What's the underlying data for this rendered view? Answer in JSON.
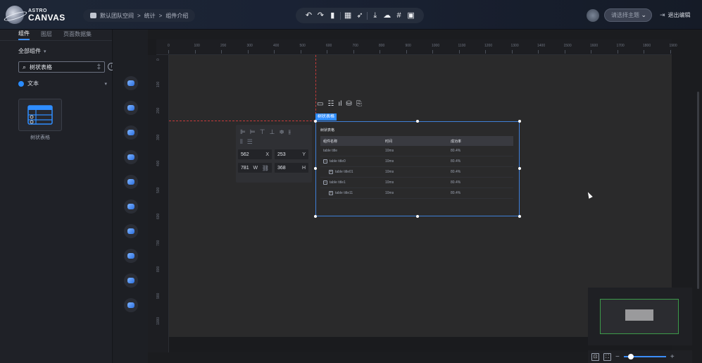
{
  "app": {
    "logo_small": "ASTRO",
    "logo_big": "CANVAS"
  },
  "breadcrumb": {
    "items": [
      "默认团队空间",
      "统计",
      "组件介绍"
    ],
    "separator": ">"
  },
  "header": {
    "theme_placeholder": "请选择主题",
    "exit_label": "退出编辑",
    "toolbar_icons": [
      "undo-icon",
      "redo-icon",
      "save-icon",
      "preview-icon",
      "publish-icon",
      "download-icon",
      "upload-icon",
      "grid-icon",
      "settings-icon"
    ]
  },
  "left_panel": {
    "tabs": [
      "组件",
      "图层",
      "页面数据集"
    ],
    "active_tab": "组件",
    "category": "全部组件",
    "search_value": "树状表格",
    "type_label": "文本",
    "component_label": "树状表格"
  },
  "rulers": {
    "top_ticks": [
      "0",
      "100",
      "200",
      "300",
      "400",
      "500",
      "600",
      "700",
      "800",
      "900",
      "1000",
      "1100",
      "1200",
      "1300",
      "1400",
      "1500",
      "1600",
      "1700",
      "1800",
      "1900"
    ],
    "left_ticks": [
      "0",
      "100",
      "200",
      "300",
      "400",
      "500",
      "600",
      "700",
      "800",
      "900",
      "1000"
    ]
  },
  "properties": {
    "x_value": "562",
    "x_label": "X",
    "y_value": "253",
    "y_label": "Y",
    "w_value": "781",
    "w_label": "W",
    "h_value": "368",
    "h_label": "H"
  },
  "widget": {
    "tag": "树状表格",
    "title": "树状表格",
    "columns": [
      "组件名称",
      "时间",
      "成功率"
    ],
    "rows": [
      {
        "name": "table title",
        "time": "10ms",
        "rate": "80.4%",
        "level": 0,
        "expander": ""
      },
      {
        "name": "table title0",
        "time": "10ms",
        "rate": "80.4%",
        "level": 0,
        "expander": "−"
      },
      {
        "name": "table title01",
        "time": "10ms",
        "rate": "80.4%",
        "level": 1,
        "expander": "+"
      },
      {
        "name": "table title1",
        "time": "10ms",
        "rate": "80.4%",
        "level": 0,
        "expander": "−"
      },
      {
        "name": "table title11",
        "time": "10ms",
        "rate": "80.4%",
        "level": 1,
        "expander": "+"
      }
    ]
  },
  "colors": {
    "accent": "#2f8dff",
    "guide": "#c33a3a",
    "minimap_frame": "#3c9a4a"
  }
}
